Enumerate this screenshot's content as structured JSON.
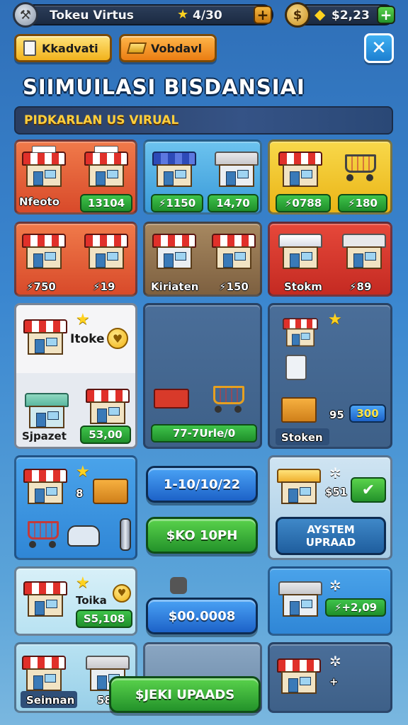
{
  "header": {
    "player_name": "Tokeu Virtus",
    "stars": "4/30",
    "coins": "$2,23",
    "plus": "+"
  },
  "toolbar": {
    "tab1_label": "Kkadvati",
    "tab2_label": "Vobdavl",
    "close_label": "✕"
  },
  "title": "SIIMUILASI BISDANSIAI",
  "banner": "PIDKARLAN US VIRUAL",
  "grid": {
    "row1": [
      {
        "label": "Nfeoto",
        "price": "13104"
      },
      {
        "label": "",
        "price_left": "1150",
        "price_right": "14,70"
      },
      {
        "label": "",
        "price_left": "0788",
        "price_right": "180"
      }
    ],
    "row2": [
      {
        "price_left": "750",
        "price_right": "19"
      },
      {
        "label": "Kiriaten",
        "price": "150"
      },
      {
        "label": "Stokm",
        "price": "89"
      }
    ],
    "row3": {
      "card1": {
        "title": "Itoke",
        "label": "Sjpazet",
        "price": "53,00"
      },
      "card2": {
        "price": "77-7Urle/0"
      },
      "card3": {
        "number": "95",
        "price": "300",
        "label": "Stoken"
      }
    },
    "row4": {
      "card1": {
        "number": "8"
      },
      "btn_blue": "1-10/10/22",
      "btn_green": "$KO 10PH",
      "card3": {
        "number": "$51",
        "button": "AYSTEM UPRAAD"
      }
    },
    "row5": {
      "card1": {
        "title": "Toika",
        "price": "S5,108"
      },
      "btn_blue": "$00.0008",
      "card3": {
        "price": "+2,09"
      }
    },
    "row6": {
      "card1": {
        "label": "Seinnan",
        "price": "58"
      },
      "btn_green": "$JEKI UPAADS",
      "card3": {
        "plus": "+"
      }
    }
  },
  "colors": {
    "red": "#e8503a",
    "blue": "#3ea6e6",
    "yellow": "#f2c52a",
    "brown": "#8a6a48",
    "green": "#3fc34b"
  }
}
